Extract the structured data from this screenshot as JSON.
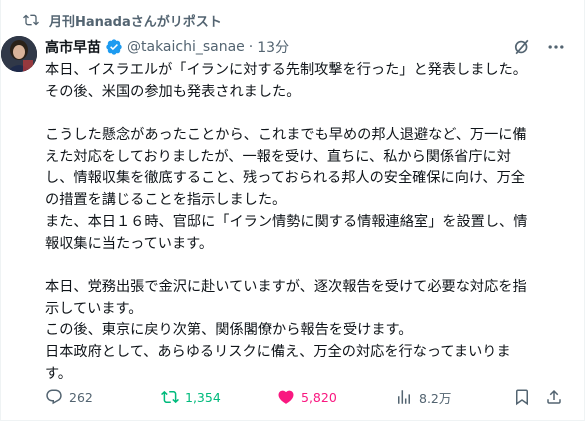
{
  "repost": {
    "text": "月刊Hanadaさんがリポスト",
    "icon": "repost-icon"
  },
  "author": {
    "name": "高市早苗",
    "handle": "@takaichi_sanae",
    "separator": "·",
    "time": "13分",
    "verified_color": "#1d9bf0"
  },
  "tweet": {
    "lines": [
      "本日、イスラエルが「イランに対する先制攻撃を行った」と発表しました。",
      "その後、米国の参加も発表されました。",
      "",
      "こうした懸念があったことから、これまでも早めの邦人退避など、万一に備",
      "えた対応をしておりましたが、一報を受け、直ちに、私から関係省庁に対",
      "し、情報収集を徹底すること、残っておられる邦人の安全確保に向け、万全",
      "の措置を講じることを指示しました。",
      "また、本日１６時、官邸に「イラン情勢に関する情報連絡室」を設置し、情",
      "報収集に当たっています。",
      "",
      "本日、党務出張で金沢に赴いていますが、逐次報告を受けて必要な対応を指",
      "示しています。",
      "この後、東京に戻り次第、関係閣僚から報告を受けます。",
      "日本政府として、あらゆるリスクに備え、万全の対応を行なってまいりま",
      "す。"
    ]
  },
  "actions": {
    "replies": "262",
    "reposts": "1,354",
    "likes": "5,820",
    "views": "8.2万"
  },
  "colors": {
    "text": "#0f1419",
    "muted": "#536471",
    "repost_green": "#00ba7c",
    "like_pink": "#f91880"
  }
}
